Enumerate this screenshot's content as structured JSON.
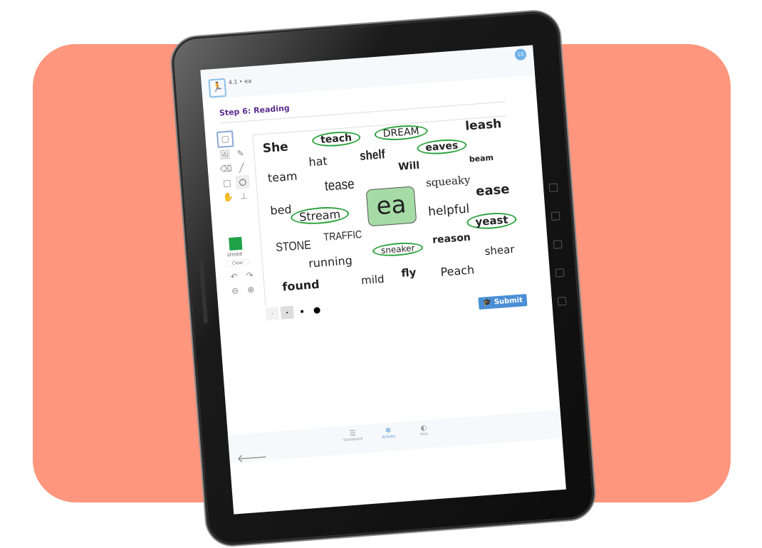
{
  "header": {
    "breadcrumb": "4.1 • ea",
    "avatar": "10",
    "logo_icon": "runner-icon"
  },
  "step_title": "Step 6: Reading",
  "tools": {
    "stroke_label": "stroke",
    "clear_label": "Clear",
    "stroke_color": "#1fa24a"
  },
  "center_card": "ea",
  "words": [
    {
      "text": "She",
      "circled": false
    },
    {
      "text": "teach",
      "circled": true
    },
    {
      "text": "DREAM",
      "circled": true
    },
    {
      "text": "leash",
      "circled": false
    },
    {
      "text": "hat",
      "circled": false
    },
    {
      "text": "shelf",
      "circled": false
    },
    {
      "text": "eaves",
      "circled": true
    },
    {
      "text": "Will",
      "circled": false
    },
    {
      "text": "beam",
      "circled": false
    },
    {
      "text": "team",
      "circled": false
    },
    {
      "text": "tease",
      "circled": false
    },
    {
      "text": "squeaky",
      "circled": false
    },
    {
      "text": "ease",
      "circled": false
    },
    {
      "text": "bed",
      "circled": false
    },
    {
      "text": "Stream",
      "circled": true
    },
    {
      "text": "helpful",
      "circled": false
    },
    {
      "text": "yeast",
      "circled": true
    },
    {
      "text": "STONE",
      "circled": false
    },
    {
      "text": "TRAFFIC",
      "circled": false
    },
    {
      "text": "sneaker",
      "circled": true
    },
    {
      "text": "reason",
      "circled": false
    },
    {
      "text": "shear",
      "circled": false
    },
    {
      "text": "running",
      "circled": false
    },
    {
      "text": "mild",
      "circled": false
    },
    {
      "text": "fly",
      "circled": false
    },
    {
      "text": "Peach",
      "circled": false
    },
    {
      "text": "found",
      "circled": false
    }
  ],
  "submit_label": "Submit",
  "nav": [
    {
      "label": "Dashboard",
      "icon": "dashboard-icon"
    },
    {
      "label": "Activity",
      "icon": "activity-icon",
      "active": true
    },
    {
      "label": "Pack",
      "icon": "pack-icon"
    }
  ],
  "accent": "#4a8fd6",
  "circle_color": "#2aa33d",
  "background": "#ff967d"
}
